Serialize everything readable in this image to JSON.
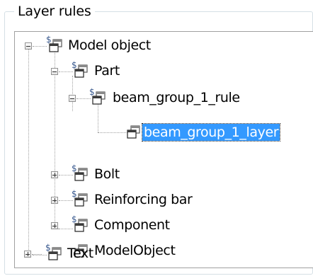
{
  "panel": {
    "title": "Layer rules"
  },
  "tree": {
    "nodes": [
      {
        "label": "Model object",
        "superscript": "$",
        "expander": "minus"
      },
      {
        "label": "Part",
        "superscript": "$",
        "expander": "minus"
      },
      {
        "label": "beam_group_1_rule",
        "superscript": "$",
        "expander": "minus"
      },
      {
        "label": "beam_group_1_layer",
        "superscript": "",
        "expander": "none",
        "selected": true
      },
      {
        "label": "Bolt",
        "superscript": "$",
        "expander": "plus"
      },
      {
        "label": "Reinforcing bar",
        "superscript": "$",
        "expander": "plus"
      },
      {
        "label": "Component",
        "superscript": "$",
        "expander": "plus"
      },
      {
        "label": "ModelObject",
        "superscript": "",
        "expander": "none"
      },
      {
        "label": "Text",
        "superscript": "$",
        "expander": "plus"
      }
    ]
  }
}
